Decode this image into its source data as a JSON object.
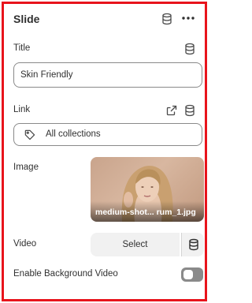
{
  "panel": {
    "title": "Slide",
    "header_icons": [
      "database-icon",
      "more-options-icon"
    ]
  },
  "fields": {
    "title": {
      "label": "Title",
      "value": "Skin Friendly"
    },
    "link": {
      "label": "Link",
      "value": "All collections"
    },
    "image": {
      "label": "Image",
      "filename": "medium-shot... rum_1.jpg"
    },
    "video": {
      "label": "Video",
      "button_label": "Select"
    },
    "enable_background_video": {
      "label": "Enable Background Video",
      "enabled": false
    }
  },
  "colors": {
    "frame_border": "#e8141c",
    "text": "#303030",
    "input_border": "#8a8a8a",
    "toggle_off": "#8a8a8a",
    "button_bg": "#f1f1f1"
  }
}
